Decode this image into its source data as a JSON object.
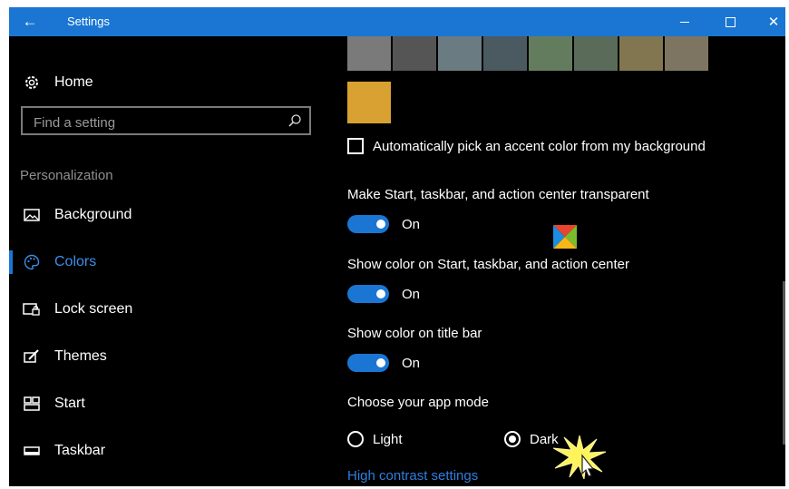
{
  "titlebar": {
    "title": "Settings",
    "back_icon": "arrow-left-icon",
    "minimize_icon": "minimize-icon",
    "maximize_icon": "maximize-icon",
    "close_icon": "close-icon",
    "color": "#1a76d2"
  },
  "sidebar": {
    "home_label": "Home",
    "search_placeholder": "Find a setting",
    "section_label": "Personalization",
    "items": [
      {
        "label": "Background",
        "icon": "image-icon",
        "active": false
      },
      {
        "label": "Colors",
        "icon": "palette-icon",
        "active": true
      },
      {
        "label": "Lock screen",
        "icon": "lock-screen-icon",
        "active": false
      },
      {
        "label": "Themes",
        "icon": "brush-icon",
        "active": false
      },
      {
        "label": "Start",
        "icon": "start-tiles-icon",
        "active": false
      },
      {
        "label": "Taskbar",
        "icon": "taskbar-icon",
        "active": false
      }
    ]
  },
  "accent_swatches": [
    "#7a7a7a",
    "#555555",
    "#6b7b82",
    "#4b5a61",
    "#647c5e",
    "#5a6b5a",
    "#827650",
    "#7d7561",
    "#d9a132"
  ],
  "content": {
    "auto_accent_label": "Automatically pick an accent color from my background",
    "transparent_label": "Make Start, taskbar, and action center transparent",
    "transparent_state": "On",
    "show_color_start_label": "Show color on Start, taskbar, and action center",
    "show_color_start_state": "On",
    "show_color_title_label": "Show color on title bar",
    "show_color_title_state": "On",
    "app_mode_label": "Choose your app mode",
    "mode_light": "Light",
    "mode_dark": "Dark",
    "selected_mode": "Dark",
    "high_contrast_link": "High contrast settings"
  }
}
